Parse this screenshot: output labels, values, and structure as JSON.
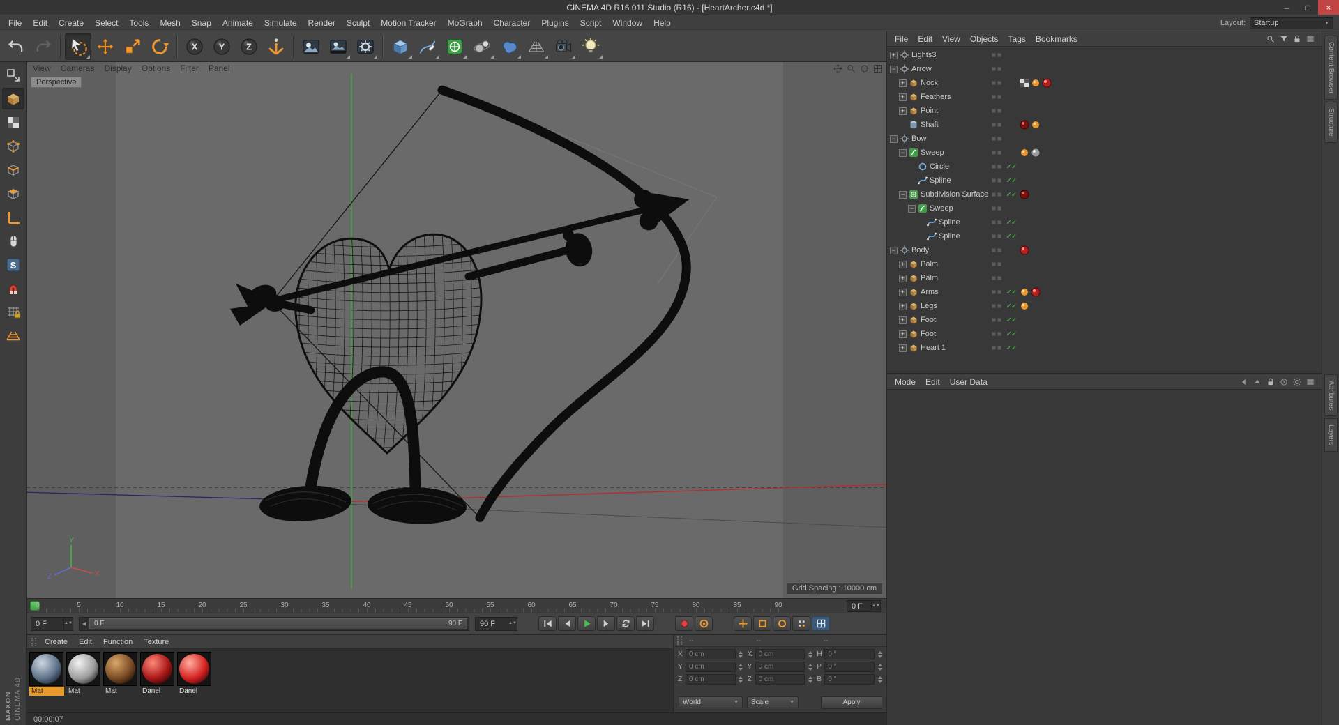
{
  "window": {
    "title": "CINEMA 4D R16.011 Studio (R16) - [HeartArcher.c4d *]",
    "controls": [
      {
        "name": "minimize",
        "glyph": "–"
      },
      {
        "name": "maximize",
        "glyph": "□"
      },
      {
        "name": "close",
        "glyph": "×"
      }
    ]
  },
  "menubar": {
    "items": [
      "File",
      "Edit",
      "Create",
      "Select",
      "Tools",
      "Mesh",
      "Snap",
      "Animate",
      "Simulate",
      "Render",
      "Sculpt",
      "Motion Tracker",
      "MoGraph",
      "Character",
      "Plugins",
      "Script",
      "Window",
      "Help"
    ],
    "layout_label": "Layout:",
    "layout_value": "Startup"
  },
  "toolbar": {
    "buttons": [
      {
        "name": "undo"
      },
      {
        "name": "redo",
        "disabled": true
      },
      {
        "sep": true
      },
      {
        "name": "live-selection",
        "corner": true,
        "active": true
      },
      {
        "name": "move"
      },
      {
        "name": "scale"
      },
      {
        "name": "rotate"
      },
      {
        "sep": true
      },
      {
        "name": "lock-x"
      },
      {
        "name": "lock-y"
      },
      {
        "name": "lock-z"
      },
      {
        "name": "coordinate-system"
      },
      {
        "sep": true
      },
      {
        "name": "render-view"
      },
      {
        "name": "render-picture-viewer",
        "corner": true
      },
      {
        "name": "render-settings",
        "corner": true
      },
      {
        "sep": true
      },
      {
        "name": "primitive-cube",
        "corner": true
      },
      {
        "name": "spline-pen",
        "corner": true
      },
      {
        "name": "generator-subdivision",
        "corner": true
      },
      {
        "name": "modeling-array",
        "corner": true
      },
      {
        "name": "simulate-metaball",
        "corner": true
      },
      {
        "name": "environment-floor",
        "corner": true
      },
      {
        "name": "camera",
        "corner": true
      },
      {
        "name": "light",
        "corner": true
      }
    ]
  },
  "sidebar": {
    "tools": [
      {
        "name": "make-editable"
      },
      {
        "name": "model-mode",
        "active": true
      },
      {
        "name": "texture-mode"
      },
      {
        "name": "points-mode"
      },
      {
        "name": "edges-mode"
      },
      {
        "name": "polygons-mode"
      },
      {
        "name": "enable-axis"
      },
      {
        "name": "viewport-solo"
      },
      {
        "name": "snap"
      },
      {
        "name": "magnet"
      },
      {
        "name": "workplane-lock"
      },
      {
        "name": "workplane"
      }
    ]
  },
  "viewport": {
    "menus": [
      "View",
      "Cameras",
      "Display",
      "Options",
      "Filter",
      "Panel"
    ],
    "camera_label": "Perspective",
    "grid_label": "Grid Spacing : 10000 cm",
    "nav_icons": [
      "pan-view",
      "zoom-view",
      "rotate-view",
      "toggle-view"
    ],
    "axis_labels": {
      "x": "X",
      "y": "Y",
      "z": "Z"
    }
  },
  "timeline": {
    "ticks": [
      "0",
      "5",
      "10",
      "15",
      "20",
      "25",
      "30",
      "35",
      "40",
      "45",
      "50",
      "55",
      "60",
      "65",
      "70",
      "75",
      "80",
      "85",
      "90"
    ],
    "current_frame": "0 F",
    "range_start": "0 F",
    "range_end": "90 F",
    "end_frame": "90 F",
    "playback": [
      {
        "name": "goto-start"
      },
      {
        "name": "previous-frame"
      },
      {
        "name": "play",
        "primary": true
      },
      {
        "name": "next-frame"
      },
      {
        "name": "loop"
      },
      {
        "name": "goto-end"
      }
    ],
    "record": [
      {
        "name": "record-keyframe"
      },
      {
        "name": "autokeying"
      }
    ],
    "record_toggles": [
      {
        "name": "record-position"
      },
      {
        "name": "record-scale"
      },
      {
        "name": "record-rotation"
      },
      {
        "name": "record-parameter"
      },
      {
        "name": "record-pla",
        "active": true
      }
    ]
  },
  "materials": {
    "menus": [
      "Create",
      "Edit",
      "Function",
      "Texture"
    ],
    "items": [
      {
        "name": "Mat",
        "selected": true,
        "colors": [
          "#cdd6e2",
          "#5e7288",
          "#141c28"
        ]
      },
      {
        "name": "Mat",
        "selected": false,
        "colors": [
          "#f2f2f2",
          "#9d9d9d",
          "#232323"
        ]
      },
      {
        "name": "Mat",
        "selected": false,
        "colors": [
          "#d8a86a",
          "#7a4a24",
          "#1a0c04"
        ]
      },
      {
        "name": "Danel",
        "selected": false,
        "colors": [
          "#ff8878",
          "#a81616",
          "#250303"
        ]
      },
      {
        "name": "Danel",
        "selected": false,
        "colors": [
          "#ffb0a0",
          "#d42222",
          "#3c0505"
        ]
      }
    ]
  },
  "coordinates": {
    "headers": [
      "--",
      "--",
      "--"
    ],
    "groups": [
      {
        "name": "position",
        "rows": [
          {
            "label": "X",
            "value": "0 cm"
          },
          {
            "label": "Y",
            "value": "0 cm"
          },
          {
            "label": "Z",
            "value": "0 cm"
          }
        ]
      },
      {
        "name": "size",
        "rows": [
          {
            "label": "X",
            "value": "0 cm"
          },
          {
            "label": "Y",
            "value": "0 cm"
          },
          {
            "label": "Z",
            "value": "0 cm"
          }
        ]
      },
      {
        "name": "rotation",
        "rows": [
          {
            "label": "H",
            "value": "0 °"
          },
          {
            "label": "P",
            "value": "0 °"
          },
          {
            "label": "B",
            "value": "0 °"
          }
        ]
      }
    ],
    "mode_select": "World",
    "scale_select": "Scale",
    "apply_label": "Apply"
  },
  "object_manager": {
    "menus": [
      "File",
      "Edit",
      "View",
      "Objects",
      "Tags",
      "Bookmarks"
    ],
    "icons": [
      "search",
      "funnel",
      "lock",
      "menu"
    ],
    "tree": [
      {
        "name": "Lights3",
        "depth": 0,
        "exp": "plus",
        "icon": "null",
        "check": false,
        "tags": []
      },
      {
        "name": "Arrow",
        "depth": 0,
        "exp": "minus",
        "icon": "null",
        "check": false,
        "tags": []
      },
      {
        "name": "Nock",
        "depth": 1,
        "exp": "plus",
        "icon": "cube",
        "check": false,
        "tags": [
          "checker",
          "phong",
          "mat-red"
        ]
      },
      {
        "name": "Feathers",
        "depth": 1,
        "exp": "plus",
        "icon": "cube",
        "check": false,
        "tags": []
      },
      {
        "name": "Point",
        "depth": 1,
        "exp": "plus",
        "icon": "cube",
        "check": false,
        "tags": []
      },
      {
        "name": "Shaft",
        "depth": 1,
        "exp": "none",
        "icon": "cylinder",
        "check": false,
        "tags": [
          "mat-darkred",
          "phong"
        ]
      },
      {
        "name": "Bow",
        "depth": 0,
        "exp": "minus",
        "icon": "null",
        "check": false,
        "tags": []
      },
      {
        "name": "Sweep",
        "depth": 1,
        "exp": "minus",
        "icon": "sweep",
        "check": false,
        "tags": [
          "phong",
          "mat-gray"
        ]
      },
      {
        "name": "Circle",
        "depth": 2,
        "exp": "none",
        "icon": "circle",
        "check": true,
        "tags": []
      },
      {
        "name": "Spline",
        "depth": 2,
        "exp": "none",
        "icon": "spline",
        "check": true,
        "tags": []
      },
      {
        "name": "Subdivision Surface",
        "depth": 1,
        "exp": "minus",
        "icon": "subdiv",
        "check": true,
        "tags": [
          "mat-darkred"
        ]
      },
      {
        "name": "Sweep",
        "depth": 2,
        "exp": "minus",
        "icon": "sweep",
        "check": false,
        "tags": []
      },
      {
        "name": "Spline",
        "depth": 3,
        "exp": "none",
        "icon": "spline",
        "check": true,
        "tags": []
      },
      {
        "name": "Spline",
        "depth": 3,
        "exp": "none",
        "icon": "spline",
        "check": true,
        "tags": []
      },
      {
        "name": "Body",
        "depth": 0,
        "exp": "minus",
        "icon": "null",
        "check": false,
        "tags": [
          "mat-red"
        ]
      },
      {
        "name": "Palm",
        "depth": 1,
        "exp": "plus",
        "icon": "cube",
        "check": false,
        "tags": []
      },
      {
        "name": "Palm",
        "depth": 1,
        "exp": "plus",
        "icon": "cube",
        "check": false,
        "tags": []
      },
      {
        "name": "Arms",
        "depth": 1,
        "exp": "plus",
        "icon": "cube",
        "check": true,
        "tags": [
          "phong",
          "mat-red"
        ]
      },
      {
        "name": "Legs",
        "depth": 1,
        "exp": "plus",
        "icon": "cube",
        "check": true,
        "tags": [
          "phong"
        ]
      },
      {
        "name": "Foot",
        "depth": 1,
        "exp": "plus",
        "icon": "cube",
        "check": true,
        "tags": []
      },
      {
        "name": "Foot",
        "depth": 1,
        "exp": "plus",
        "icon": "cube",
        "check": true,
        "tags": []
      },
      {
        "name": "Heart 1",
        "depth": 1,
        "exp": "plus",
        "icon": "cube",
        "check": true,
        "tags": []
      }
    ]
  },
  "attribute_manager": {
    "menus": [
      "Mode",
      "Edit",
      "User Data"
    ],
    "icons": [
      "back",
      "up",
      "lock",
      "history",
      "gear",
      "menu"
    ]
  },
  "right_tabs": {
    "top": [
      "Content Browser",
      "Structure"
    ],
    "middle": [
      "Attributes",
      "Layers"
    ]
  },
  "statusbar": {
    "time": "00:00:07"
  },
  "branding": {
    "line1": "MAXON",
    "line2": "CINEMA 4D"
  }
}
